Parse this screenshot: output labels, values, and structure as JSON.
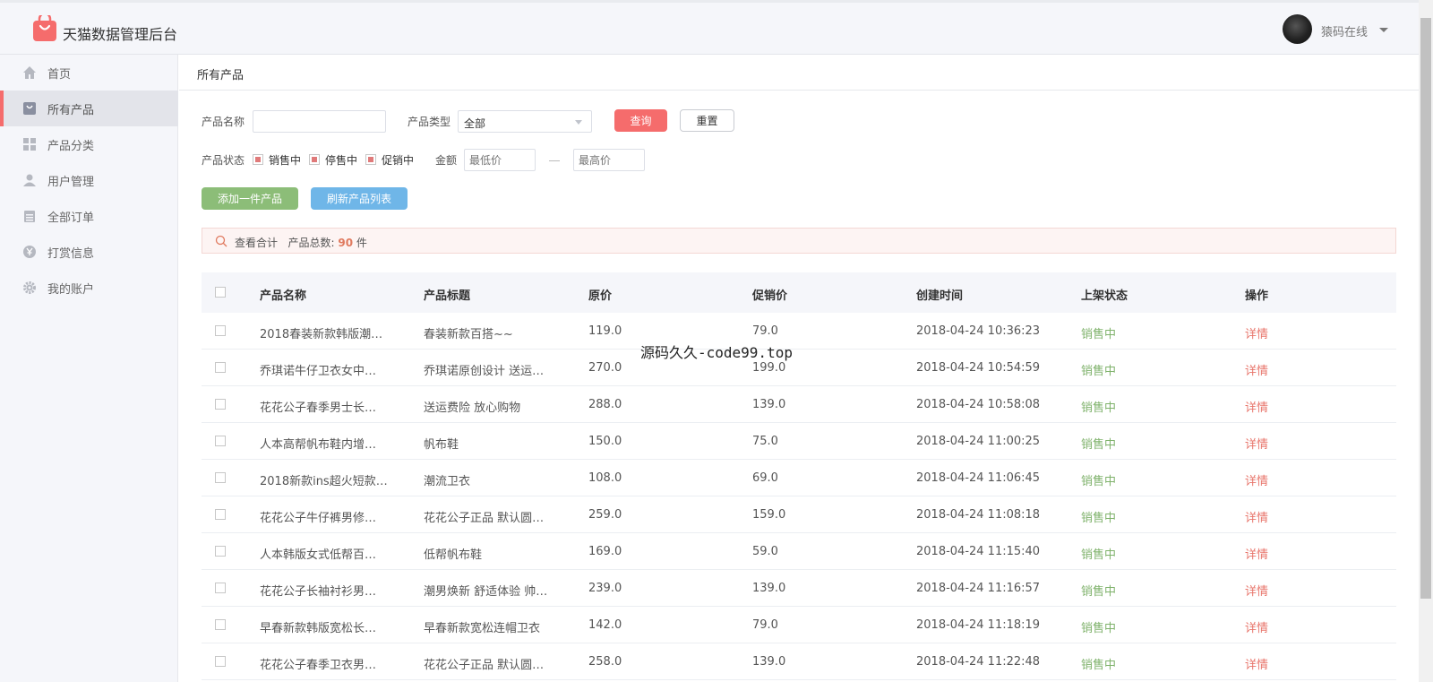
{
  "header": {
    "brand": "天猫数据管理后台",
    "username": "猿码在线"
  },
  "sidebar": {
    "items": [
      {
        "label": "首页",
        "icon": "home-icon"
      },
      {
        "label": "所有产品",
        "icon": "bag-icon",
        "active": true
      },
      {
        "label": "产品分类",
        "icon": "grid-icon"
      },
      {
        "label": "用户管理",
        "icon": "user-icon"
      },
      {
        "label": "全部订单",
        "icon": "clipboard-icon"
      },
      {
        "label": "打赏信息",
        "icon": "yen-icon"
      },
      {
        "label": "我的账户",
        "icon": "gear-icon"
      }
    ]
  },
  "breadcrumb": "所有产品",
  "filters": {
    "name_label": "产品名称",
    "name_value": "",
    "type_label": "产品类型",
    "type_value": "全部",
    "query_label": "查询",
    "reset_label": "重置",
    "status_label": "产品状态",
    "status_options": [
      "销售中",
      "停售中",
      "促销中"
    ],
    "amount_label": "金额",
    "min_placeholder": "最低价",
    "max_placeholder": "最高价",
    "add_label": "添加一件产品",
    "refresh_label": "刷新产品列表"
  },
  "summary": {
    "prefix": "查看合计",
    "total_label": "产品总数:",
    "total_count": "90",
    "unit": "件"
  },
  "table": {
    "columns": [
      "产品名称",
      "产品标题",
      "原价",
      "促销价",
      "创建时间",
      "上架状态",
      "操作"
    ],
    "rows": [
      {
        "name": "2018春装新款韩版潮…",
        "title": "春装新款百搭~~",
        "price": "119.0",
        "promo": "79.0",
        "time": "2018-04-24 10:36:23",
        "status": "销售中",
        "action": "详情"
      },
      {
        "name": "乔琪诺牛仔卫衣女中…",
        "title": "乔琪诺原创设计 送运…",
        "price": "270.0",
        "promo": "199.0",
        "time": "2018-04-24 10:54:59",
        "status": "销售中",
        "action": "详情"
      },
      {
        "name": "花花公子春季男士长…",
        "title": "送运费险 放心购物",
        "price": "288.0",
        "promo": "139.0",
        "time": "2018-04-24 10:58:08",
        "status": "销售中",
        "action": "详情"
      },
      {
        "name": "人本高帮帆布鞋内增…",
        "title": "帆布鞋",
        "price": "150.0",
        "promo": "75.0",
        "time": "2018-04-24 11:00:25",
        "status": "销售中",
        "action": "详情"
      },
      {
        "name": "2018新款ins超火短款…",
        "title": "潮流卫衣",
        "price": "108.0",
        "promo": "69.0",
        "time": "2018-04-24 11:06:45",
        "status": "销售中",
        "action": "详情"
      },
      {
        "name": "花花公子牛仔裤男修…",
        "title": "花花公子正品 默认圆…",
        "price": "259.0",
        "promo": "159.0",
        "time": "2018-04-24 11:08:18",
        "status": "销售中",
        "action": "详情"
      },
      {
        "name": "人本韩版女式低帮百…",
        "title": "低帮帆布鞋",
        "price": "169.0",
        "promo": "59.0",
        "time": "2018-04-24 11:15:40",
        "status": "销售中",
        "action": "详情"
      },
      {
        "name": "花花公子长袖衬衫男…",
        "title": "潮男焕新 舒适体验 帅…",
        "price": "239.0",
        "promo": "139.0",
        "time": "2018-04-24 11:16:57",
        "status": "销售中",
        "action": "详情"
      },
      {
        "name": "早春新款韩版宽松长…",
        "title": "早春新款宽松连帽卫衣",
        "price": "142.0",
        "promo": "79.0",
        "time": "2018-04-24 11:18:19",
        "status": "销售中",
        "action": "详情"
      },
      {
        "name": "花花公子春季卫衣男…",
        "title": "花花公子正品 默认圆…",
        "price": "258.0",
        "promo": "139.0",
        "time": "2018-04-24 11:22:48",
        "status": "销售中",
        "action": "详情"
      }
    ]
  },
  "watermark": "源码久久-code99.top",
  "colors": {
    "accent": "#f56c6c",
    "add_button": "#8cbd78",
    "refresh_button": "#6fb6e8",
    "status_green": "#7fb26b",
    "detail_red": "#e8756b"
  }
}
